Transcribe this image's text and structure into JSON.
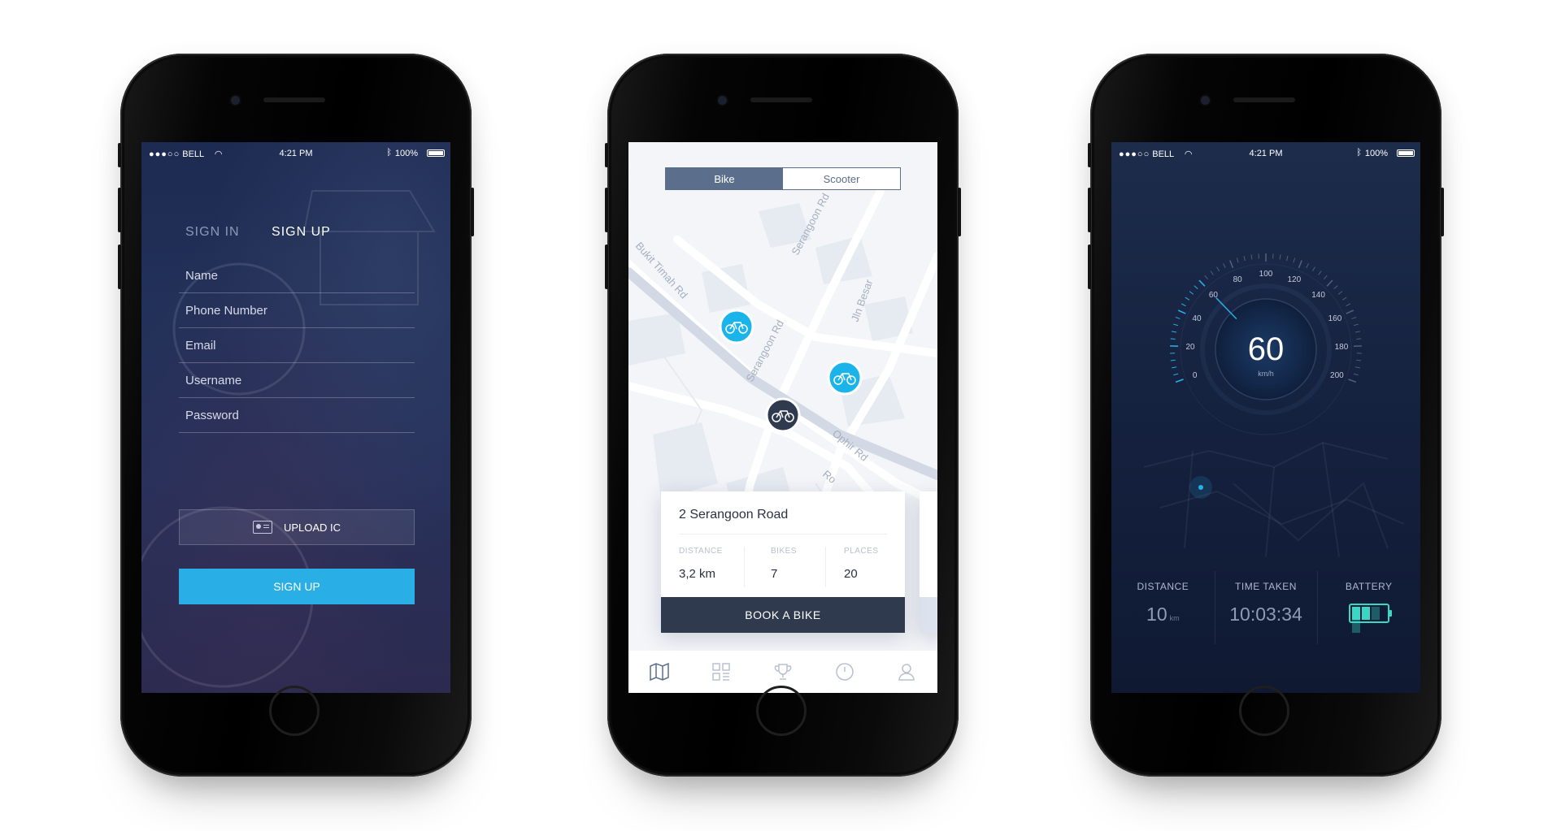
{
  "status_bar": {
    "carrier": "BELL",
    "time": "4:21 PM",
    "battery": "100%"
  },
  "signup_screen": {
    "tab_sign_in": "SIGN IN",
    "tab_sign_up": "SIGN UP",
    "fields": [
      {
        "label": "Name"
      },
      {
        "label": "Phone Number"
      },
      {
        "label": "Email"
      },
      {
        "label": "Username"
      },
      {
        "label": "Password"
      }
    ],
    "upload_label": "UPLOAD IC",
    "submit_label": "SIGN UP"
  },
  "map_screen": {
    "segments": [
      "Bike",
      "Scooter"
    ],
    "selected_segment": "Bike",
    "street_labels": [
      "Bukit Timah Rd",
      "Serangoon Rd",
      "Serangoon Rd",
      "Jln Besar",
      "Ophir Rd",
      "Ro"
    ],
    "station": {
      "address": "2 Serangoon Road",
      "distance_label": "DISTANCE",
      "distance_value": "3,2 km",
      "bikes_label": "BIKES",
      "bikes_value": "7",
      "places_label": "PLACES",
      "places_value": "20",
      "book_label": "BOOK A BIKE"
    },
    "nav_icons": [
      "map-icon",
      "grid-icon",
      "trophy-icon",
      "history-icon",
      "profile-icon"
    ],
    "colors": {
      "accent": "#1ab4ea",
      "dark": "#2f3a4e"
    }
  },
  "speed_screen": {
    "speed_value": "60",
    "speed_unit": "km/h",
    "scale_labels": [
      "0",
      "20",
      "40",
      "60",
      "80",
      "100",
      "120",
      "140",
      "160",
      "180",
      "200"
    ],
    "distance_label": "DISTANCE",
    "distance_value": "10",
    "distance_unit": "km",
    "time_label": "TIME TAKEN",
    "time_value": "10:03:34",
    "battery_label": "BATTERY",
    "battery_level": 0.6,
    "colors": {
      "accent": "#39d7c4",
      "needle": "#29aee6"
    }
  }
}
